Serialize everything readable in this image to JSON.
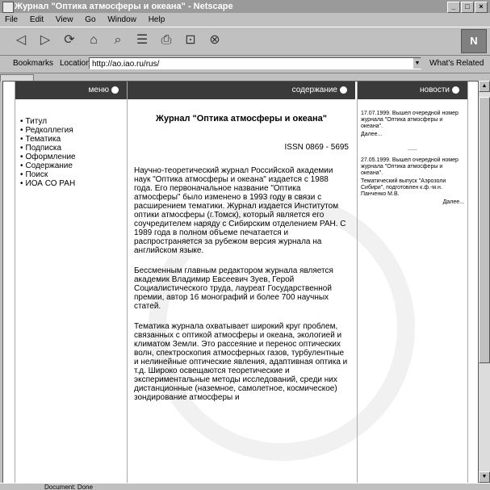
{
  "window": {
    "title": "Журнал \"Оптика атмосферы и океана\" - Netscape"
  },
  "menubar": [
    "File",
    "Edit",
    "View",
    "Go",
    "Window",
    "Help"
  ],
  "toolbar": {
    "back_icon": "back-arrow-icon",
    "forward_icon": "forward-arrow-icon",
    "reload_icon": "reload-icon",
    "home_icon": "home-icon",
    "search_icon": "search-icon",
    "guide_icon": "guide-icon",
    "print_icon": "print-icon",
    "security_icon": "lock-icon",
    "stop_icon": "stop-icon",
    "logo": "N"
  },
  "location": {
    "bookmarks_label": "Bookmarks",
    "location_label": "Location:",
    "url": "http://ao.iao.ru/rus/",
    "related_label": "What's Related"
  },
  "page": {
    "menu_header": "меню",
    "main_header": "содержание",
    "news_header": "новости",
    "menu_items": [
      "Титул",
      "Редколлегия",
      "Тематика",
      "Подписка",
      "Оформление",
      "Содержание",
      "Поиск",
      "ИОА СО РАН"
    ],
    "title": "Журнал \"Оптика атмосферы и океана\"",
    "issn": "ISSN 0869 - 5695",
    "paragraphs": [
      "Научно-теоретический журнал Российской академии наук \"Оптика атмосферы и океана\" издается с 1988 года. Его первоначальное название \"Оптика атмосферы\" было изменено в 1993 году в связи с расширением тематики. Журнал издается Институтом оптики атмосферы (г.Томск), который является его соучредителем наряду с Сибирским отделением РАН. С 1989 года в полном объеме печатается и распространяется за рубежом версия журнала на английском языке.",
      "Бессменным главным редактором журнала является академик Владимир Евсеевич Зуев, Герой Социалистического труда, лауреат Государственной премии, автор 16 монографий и более 700 научных статей.",
      "Тематика журнала охватывает широкий круг проблем, связанных с оптикой атмосферы и океана, экологией и климатом Земли. Это рассеяние и перенос оптических волн, спектроскопия атмосферных газов, турбулентные и нелинейные оптические явления, адаптивная оптика и т.д. Широко освещаются теоретические и экспериментальные методы исследований, среди них дистанционные (наземное, самолетное, космическое) зондирование атмосферы и"
    ],
    "news": [
      "17.07.1999. Вышел  очередной номер журнала \"Оптика атмосферы и океана\".",
      "Далее...",
      "27.05.1999. Вышел  очередной номер журнала \"Оптика атмосферы и океана\".",
      "Тематический выпуск \"Аэрозоли Сибири\", подготовлен к.ф.-м.н. Панченко М.В.",
      "Далее..."
    ],
    "news_dots": "......"
  },
  "status": {
    "text": "Document: Done"
  }
}
